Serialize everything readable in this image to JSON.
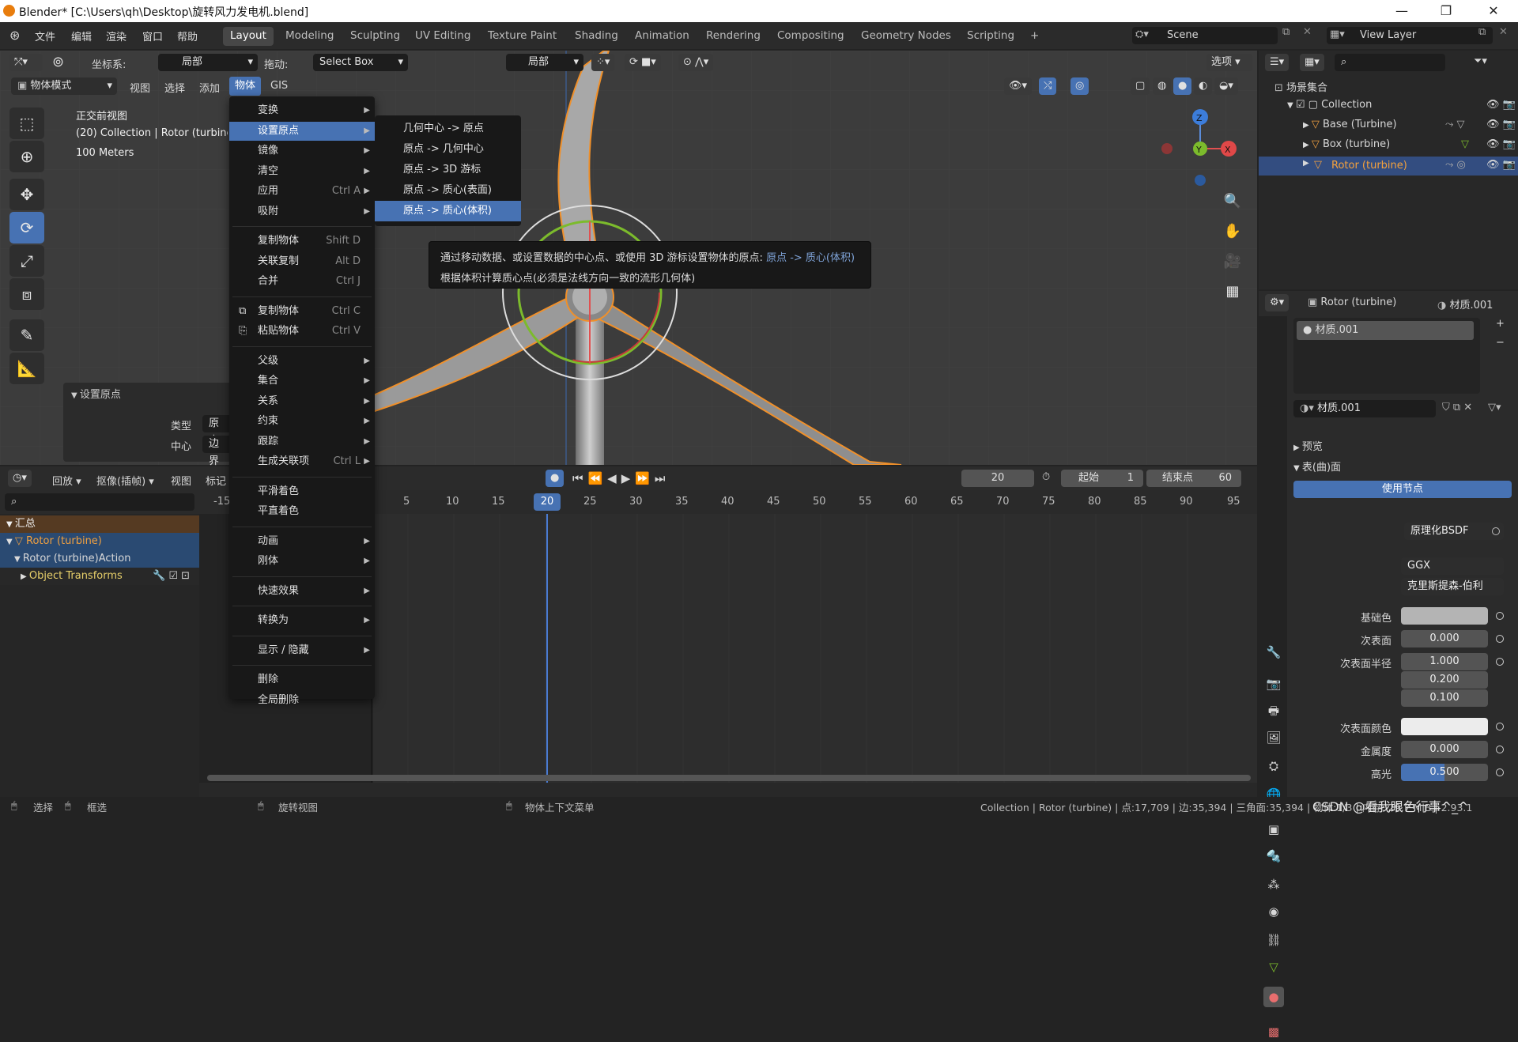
{
  "window": {
    "title": "Blender* [C:\\Users\\qh\\Desktop\\旋转风力发电机.blend]"
  },
  "top_menus": [
    "文件",
    "编辑",
    "渲染",
    "窗口",
    "帮助"
  ],
  "workspaces": [
    "Layout",
    "Modeling",
    "Sculpting",
    "UV Editing",
    "Texture Paint",
    "Shading",
    "Animation",
    "Rendering",
    "Compositing",
    "Geometry Nodes",
    "Scripting"
  ],
  "workspace_add": "+",
  "scene": {
    "name": "Scene"
  },
  "view_layer": {
    "name": "View Layer"
  },
  "header": {
    "coord_label": "坐标系:",
    "coord_value": "局部",
    "drag_label": "拖动:",
    "drag_value": "Select Box",
    "pivot_value": "局部",
    "options": "选项"
  },
  "vp_header": {
    "mode": "物体模式",
    "menus": [
      "视图",
      "选择",
      "添加",
      "物体",
      "GIS"
    ]
  },
  "viewport_info": {
    "line1": "正交前视图",
    "line2": "(20) Collection | Rotor (turbine)",
    "line3": "100 Meters"
  },
  "gizmo": {
    "z": "Z",
    "y": "Y",
    "x": "X"
  },
  "object_menu": {
    "items": [
      {
        "label": "变换",
        "shortcut": "",
        "arrow": true
      },
      {
        "label": "设置原点",
        "shortcut": "",
        "arrow": true,
        "highlight": true
      },
      {
        "label": "镜像",
        "shortcut": "",
        "arrow": true
      },
      {
        "label": "清空",
        "shortcut": "",
        "arrow": true
      },
      {
        "label": "应用",
        "shortcut": "Ctrl A",
        "arrow": true
      },
      {
        "label": "吸附",
        "shortcut": "",
        "arrow": true
      },
      {
        "label": "复制物体",
        "shortcut": "Shift D",
        "arrow": false
      },
      {
        "label": "关联复制",
        "shortcut": "Alt D",
        "arrow": false
      },
      {
        "label": "合并",
        "shortcut": "Ctrl J",
        "arrow": false
      },
      {
        "label": "复制物体",
        "shortcut": "Ctrl C",
        "arrow": false
      },
      {
        "label": "粘贴物体",
        "shortcut": "Ctrl V",
        "arrow": false
      },
      {
        "label": "父级",
        "shortcut": "",
        "arrow": true
      },
      {
        "label": "集合",
        "shortcut": "",
        "arrow": true
      },
      {
        "label": "关系",
        "shortcut": "",
        "arrow": true
      },
      {
        "label": "约束",
        "shortcut": "",
        "arrow": true
      },
      {
        "label": "跟踪",
        "shortcut": "",
        "arrow": true
      },
      {
        "label": "生成关联项",
        "shortcut": "Ctrl L",
        "arrow": true
      },
      {
        "label": "平滑着色",
        "shortcut": "",
        "arrow": false
      },
      {
        "label": "平直着色",
        "shortcut": "",
        "arrow": false
      },
      {
        "label": "动画",
        "shortcut": "",
        "arrow": true
      },
      {
        "label": "刚体",
        "shortcut": "",
        "arrow": true
      },
      {
        "label": "快速效果",
        "shortcut": "",
        "arrow": true
      },
      {
        "label": "转换为",
        "shortcut": "",
        "arrow": true
      },
      {
        "label": "显示 / 隐藏",
        "shortcut": "",
        "arrow": true
      },
      {
        "label": "删除",
        "shortcut": "",
        "arrow": false
      },
      {
        "label": "全局删除",
        "shortcut": "",
        "arrow": false
      }
    ]
  },
  "origin_submenu": [
    "几何中心 -> 原点",
    "原点 -> 几何中心",
    "原点 -> 3D 游标",
    "原点 -> 质心(表面)",
    "原点 -> 质心(体积)"
  ],
  "tooltip": {
    "line1": "通过移动数据、或设置数据的中心点、或使用 3D 游标设置物体的原点:",
    "line1_hl": "原点 -> 质心(体积)",
    "line2": "根据体积计算质心点(必须是法线方向一致的流形几何体)"
  },
  "op_panel": {
    "title": "设置原点",
    "type_label": "类型",
    "type_value": "原点",
    "center_label": "中心",
    "center_value": "边界"
  },
  "timeline": {
    "menus": [
      "回放",
      "抠像(插帧)",
      "视图",
      "标记"
    ],
    "current_frame": "20",
    "start_label": "起始",
    "start": "1",
    "end_label": "结束点",
    "end": "60",
    "ticks": [
      "-15",
      "5",
      "10",
      "15",
      "20",
      "25",
      "30",
      "35",
      "40",
      "45",
      "50",
      "55",
      "60",
      "65",
      "70",
      "75",
      "80",
      "85",
      "90",
      "95"
    ]
  },
  "dopesheet": {
    "summary": "汇总",
    "object": "Rotor (turbine)",
    "action": "Rotor (turbine)Action",
    "transforms": "Object Transforms"
  },
  "outliner": {
    "root": "场景集合",
    "collection": "Collection",
    "objects": [
      "Base (Turbine)",
      "Box (turbine)",
      "Rotor (turbine)"
    ]
  },
  "properties": {
    "object_name": "Rotor (turbine)",
    "material_name": "材质.001",
    "slot": "材质.001",
    "mat_field": "材质.001",
    "preview": "预览",
    "surface_section": "表(曲)面",
    "use_nodes": "使用节点",
    "rows": [
      {
        "label": "表(曲)面",
        "value": "原理化BSDF"
      },
      {
        "label": "",
        "value": "GGX"
      },
      {
        "label": "",
        "value": "克里斯提森-伯利"
      },
      {
        "label": "基础色",
        "value": ""
      },
      {
        "label": "次表面",
        "value": "0.000"
      },
      {
        "label": "次表面半径",
        "value": "1.000"
      },
      {
        "label": "",
        "value": "0.200"
      },
      {
        "label": "",
        "value": "0.100"
      },
      {
        "label": "次表面颜色",
        "value": ""
      },
      {
        "label": "金属度",
        "value": "0.000"
      },
      {
        "label": "高光",
        "value": "0.500"
      }
    ]
  },
  "status": {
    "select": "选择",
    "box": "框选",
    "rotate": "旋转视图",
    "ctx": "物体上下文菜单",
    "info": "Collection | Rotor (turbine) | 点:17,709 | 边:35,394 | 三角面:35,394 | 物体:1/3 | 内存: 29.7 MiB | 2.93.1",
    "watermark": "CSDN @看我眼色行事^_^"
  },
  "colors": {
    "accent": "#4772b3",
    "selected_outline": "#f0902a",
    "blade": "#9a9a9a"
  }
}
